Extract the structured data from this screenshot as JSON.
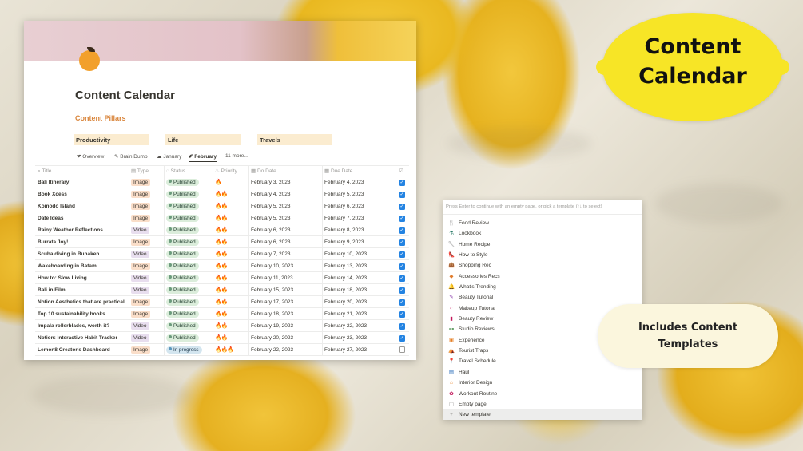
{
  "page": {
    "title": "Content Calendar",
    "section_heading": "Content Pillars",
    "pillars": [
      "Productivity",
      "Life",
      "Travels"
    ]
  },
  "views": [
    {
      "icon": "❤",
      "label": "Overview"
    },
    {
      "icon": "✎",
      "label": "Brain Dump"
    },
    {
      "icon": "☁",
      "label": "January"
    },
    {
      "icon": "✐",
      "label": "February"
    },
    {
      "icon": "",
      "label": "11 more..."
    }
  ],
  "active_view": "February",
  "columns": {
    "title": "Title",
    "type": "Type",
    "status": "Status",
    "priority": "Priority",
    "do_date": "Do Date",
    "due_date": "Due Date"
  },
  "rows": [
    {
      "title": "Bali Itinerary",
      "type": "Image",
      "status": "Published",
      "priority": "🔥",
      "do": "February 3, 2023",
      "due": "February 4, 2023",
      "done": true
    },
    {
      "title": "Book Xcess",
      "type": "Image",
      "status": "Published",
      "priority": "🔥🔥",
      "do": "February 4, 2023",
      "due": "February 5, 2023",
      "done": true
    },
    {
      "title": "Komodo Island",
      "type": "Image",
      "status": "Published",
      "priority": "🔥🔥",
      "do": "February 5, 2023",
      "due": "February 6, 2023",
      "done": true
    },
    {
      "title": "Date Ideas",
      "type": "Image",
      "status": "Published",
      "priority": "🔥🔥",
      "do": "February 5, 2023",
      "due": "February 7, 2023",
      "done": true
    },
    {
      "title": "Rainy Weather Reflections",
      "type": "Video",
      "status": "Published",
      "priority": "🔥🔥",
      "do": "February 6, 2023",
      "due": "February 8, 2023",
      "done": true
    },
    {
      "title": "Burrata Joy!",
      "type": "Image",
      "status": "Published",
      "priority": "🔥🔥",
      "do": "February 6, 2023",
      "due": "February 9, 2023",
      "done": true
    },
    {
      "title": "Scuba diving in Bunaken",
      "type": "Video",
      "status": "Published",
      "priority": "🔥🔥",
      "do": "February 7, 2023",
      "due": "February 10, 2023",
      "done": true
    },
    {
      "title": "Wakeboarding in Batam",
      "type": "Image",
      "status": "Published",
      "priority": "🔥🔥",
      "do": "February 10, 2023",
      "due": "February 13, 2023",
      "done": true
    },
    {
      "title": "How to: Slow Living",
      "type": "Video",
      "status": "Published",
      "priority": "🔥🔥",
      "do": "February 11, 2023",
      "due": "February 14, 2023",
      "done": true
    },
    {
      "title": "Bali in Film",
      "type": "Video",
      "status": "Published",
      "priority": "🔥🔥",
      "do": "February 15, 2023",
      "due": "February 18, 2023",
      "done": true
    },
    {
      "title": "Notion Aesthetics that are practical",
      "type": "Image",
      "status": "Published",
      "priority": "🔥🔥",
      "do": "February 17, 2023",
      "due": "February 20, 2023",
      "done": true
    },
    {
      "title": "Top 10 sustainability books",
      "type": "Image",
      "status": "Published",
      "priority": "🔥🔥",
      "do": "February 18, 2023",
      "due": "February 21, 2023",
      "done": true
    },
    {
      "title": "Impala rollerblades, worth it?",
      "type": "Video",
      "status": "Published",
      "priority": "🔥🔥",
      "do": "February 19, 2023",
      "due": "February 22, 2023",
      "done": true
    },
    {
      "title": "Notion: Interactive Habit Tracker",
      "type": "Video",
      "status": "Published",
      "priority": "🔥🔥",
      "do": "February 20, 2023",
      "due": "February 23, 2023",
      "done": true
    },
    {
      "title": "Lemon8 Creator's Dashboard",
      "type": "Image",
      "status": "In progress",
      "priority": "🔥🔥🔥",
      "do": "February 22, 2023",
      "due": "February 27, 2023",
      "done": false
    }
  ],
  "template_panel": {
    "hint": "Press Enter to continue with an empty page, or pick a template (↑↓ to select)",
    "items": [
      {
        "icon": "fork-knife-icon",
        "glyph": "🍴",
        "color": "#c0392b",
        "label": "Food Review"
      },
      {
        "icon": "flask-icon",
        "glyph": "⚗",
        "color": "#2e7d6b",
        "label": "Lookbook"
      },
      {
        "icon": "fork-spoon-icon",
        "glyph": "🥄",
        "color": "#c0392b",
        "label": "Home Recipe"
      },
      {
        "icon": "shoe-icon",
        "glyph": "👠",
        "color": "#d0314d",
        "label": "How to Style"
      },
      {
        "icon": "bag-icon",
        "glyph": "👜",
        "color": "#d63a7a",
        "label": "Shopping Rec"
      },
      {
        "icon": "diamond-icon",
        "glyph": "◆",
        "color": "#e07b2b",
        "label": "Accessories Recs"
      },
      {
        "icon": "bell-icon",
        "glyph": "🔔",
        "color": "#e0a02b",
        "label": "What's Trending"
      },
      {
        "icon": "brush-icon",
        "glyph": "✎",
        "color": "#8e44ad",
        "label": "Beauty Tutorial"
      },
      {
        "icon": "mirror-icon",
        "glyph": "◐",
        "color": "#c2185b",
        "label": "Makeup Tutorial"
      },
      {
        "icon": "lipstick-icon",
        "glyph": "▮",
        "color": "#c2185b",
        "label": "Beauty Review"
      },
      {
        "icon": "dumbbell-icon",
        "glyph": "⊶",
        "color": "#2e7d32",
        "label": "Studio Reviews"
      },
      {
        "icon": "ticket-icon",
        "glyph": "▣",
        "color": "#e67e22",
        "label": "Experience"
      },
      {
        "icon": "tent-icon",
        "glyph": "⛺",
        "color": "#d35400",
        "label": "Tourist Traps"
      },
      {
        "icon": "pin-icon",
        "glyph": "📍",
        "color": "#16a085",
        "label": "Travel Schedule"
      },
      {
        "icon": "shop-icon",
        "glyph": "▤",
        "color": "#2c6fbb",
        "label": "Haul"
      },
      {
        "icon": "house-icon",
        "glyph": "⌂",
        "color": "#e67e22",
        "label": "Interior Design"
      },
      {
        "icon": "yoga-icon",
        "glyph": "✿",
        "color": "#c2185b",
        "label": "Workout Routine"
      },
      {
        "icon": "page-icon",
        "glyph": "▢",
        "color": "#9b9a97",
        "label": "Empty page"
      },
      {
        "icon": "plus-icon",
        "glyph": "+",
        "color": "#9b9a97",
        "label": "New template"
      }
    ]
  },
  "stickers": {
    "lemon_line1": "Content",
    "lemon_line2": "Calendar",
    "cream_line1": "Includes Content",
    "cream_line2": "Templates"
  },
  "colors": {
    "accent_orange": "#d9853b",
    "pillar_bg": "#fbecd0",
    "checkbox_blue": "#2383e2",
    "lemon_yellow": "#f7e526"
  }
}
